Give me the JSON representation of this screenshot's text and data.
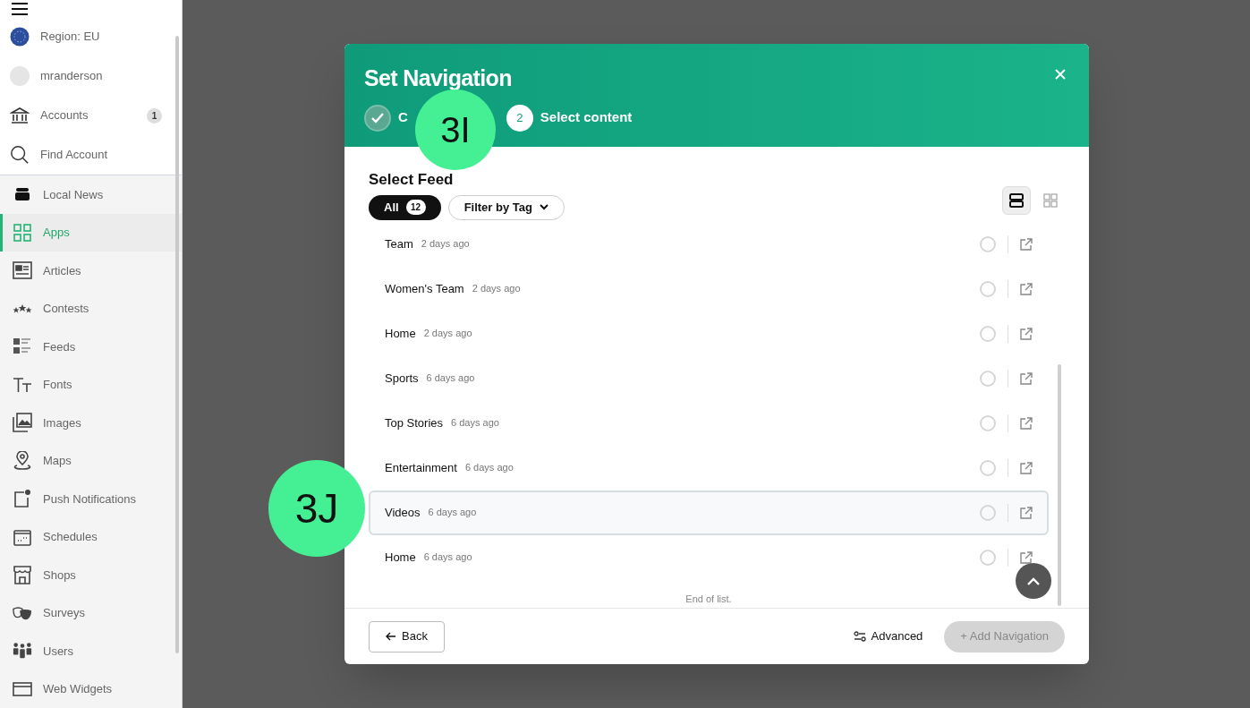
{
  "sidebar": {
    "top_items": [
      {
        "kind": "region",
        "label": "Region: EU"
      },
      {
        "kind": "user",
        "label": "mranderson"
      },
      {
        "kind": "accounts",
        "label": "Accounts",
        "badge": "1"
      },
      {
        "kind": "search",
        "label": "Find Account"
      }
    ],
    "items": [
      {
        "kind": "news",
        "label": "Local News",
        "selected": false
      },
      {
        "kind": "apps",
        "label": "Apps",
        "selected": true
      },
      {
        "kind": "articles",
        "label": "Articles",
        "selected": false
      },
      {
        "kind": "contests",
        "label": "Contests",
        "selected": false
      },
      {
        "kind": "feeds",
        "label": "Feeds",
        "selected": false
      },
      {
        "kind": "fonts",
        "label": "Fonts",
        "selected": false
      },
      {
        "kind": "images",
        "label": "Images",
        "selected": false
      },
      {
        "kind": "maps",
        "label": "Maps",
        "selected": false
      },
      {
        "kind": "push",
        "label": "Push Notifications",
        "selected": false
      },
      {
        "kind": "schedules",
        "label": "Schedules",
        "selected": false
      },
      {
        "kind": "shops",
        "label": "Shops",
        "selected": false
      },
      {
        "kind": "surveys",
        "label": "Surveys",
        "selected": false
      },
      {
        "kind": "users",
        "label": "Users",
        "selected": false
      },
      {
        "kind": "widgets",
        "label": "Web Widgets",
        "selected": false
      }
    ]
  },
  "dialog": {
    "title": "Set Navigation",
    "steps": [
      {
        "label": "C",
        "done": true
      },
      {
        "number": "2",
        "label": "Select content",
        "done": false
      }
    ],
    "section_title": "Select Feed",
    "filters": [
      {
        "kind": "all",
        "label": "All",
        "count": "12",
        "selected": true
      },
      {
        "kind": "dropdown",
        "label": "Filter by Tag",
        "selected": false
      }
    ],
    "views": [
      {
        "kind": "list",
        "selected": true
      },
      {
        "kind": "grid",
        "selected": false
      }
    ],
    "rows": [
      {
        "name": "Team",
        "time": "2 days ago",
        "highlighted": false
      },
      {
        "name": "Women's Team",
        "time": "2 days ago",
        "highlighted": false
      },
      {
        "name": "Home",
        "time": "2 days ago",
        "highlighted": false
      },
      {
        "name": "Sports",
        "time": "6 days ago",
        "highlighted": false
      },
      {
        "name": "Top Stories",
        "time": "6 days ago",
        "highlighted": false
      },
      {
        "name": "Entertainment",
        "time": "6 days ago",
        "highlighted": false
      },
      {
        "name": "Videos",
        "time": "6 days ago",
        "highlighted": true
      },
      {
        "name": "Home",
        "time": "6 days ago",
        "highlighted": false
      }
    ],
    "end_text": "End of list.",
    "back_button": "Back",
    "advanced_button": "Advanced",
    "add_button": {
      "label": "+ Add Navigation",
      "disabled": true
    }
  },
  "callouts": [
    {
      "label": "3I"
    },
    {
      "label": "3J"
    }
  ]
}
